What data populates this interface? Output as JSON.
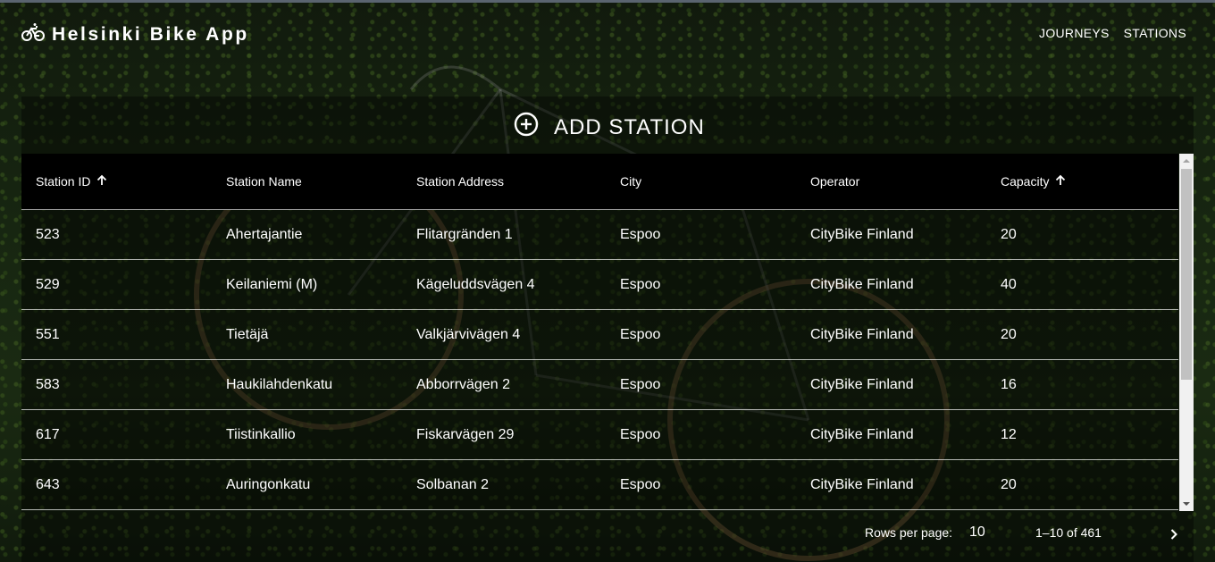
{
  "header": {
    "title": "Helsinki Bike App",
    "nav": [
      "JOURNEYS",
      "STATIONS"
    ]
  },
  "actions": {
    "add_station": "ADD STATION"
  },
  "table": {
    "columns": [
      "Station ID",
      "Station Name",
      "Station Address",
      "City",
      "Operator",
      "Capacity"
    ],
    "rows": [
      [
        "523",
        "Ahertajantie",
        "Flitargränden 1",
        "Espoo",
        "CityBike Finland",
        "20"
      ],
      [
        "529",
        "Keilaniemi (M)",
        "Kägeluddsvägen 4",
        "Espoo",
        "CityBike Finland",
        "40"
      ],
      [
        "551",
        "Tietäjä",
        "Valkjärvivägen 4",
        "Espoo",
        "CityBike Finland",
        "20"
      ],
      [
        "583",
        "Haukilahdenkatu",
        "Abborrvägen 2",
        "Espoo",
        "CityBike Finland",
        "16"
      ],
      [
        "617",
        "Tiistinkallio",
        "Fiskarvägen 29",
        "Espoo",
        "CityBike Finland",
        "12"
      ],
      [
        "643",
        "Auringonkatu",
        "Solbanan 2",
        "Espoo",
        "CityBike Finland",
        "20"
      ]
    ]
  },
  "pagination": {
    "rows_per_page_label": "Rows per page:",
    "rows_per_page": "10",
    "range": "1–10 of 461"
  },
  "icons": {
    "brand": "bike-icon",
    "add": "add-circle-icon",
    "sort": "arrow-up-icon",
    "next": "chevron-right-icon"
  }
}
